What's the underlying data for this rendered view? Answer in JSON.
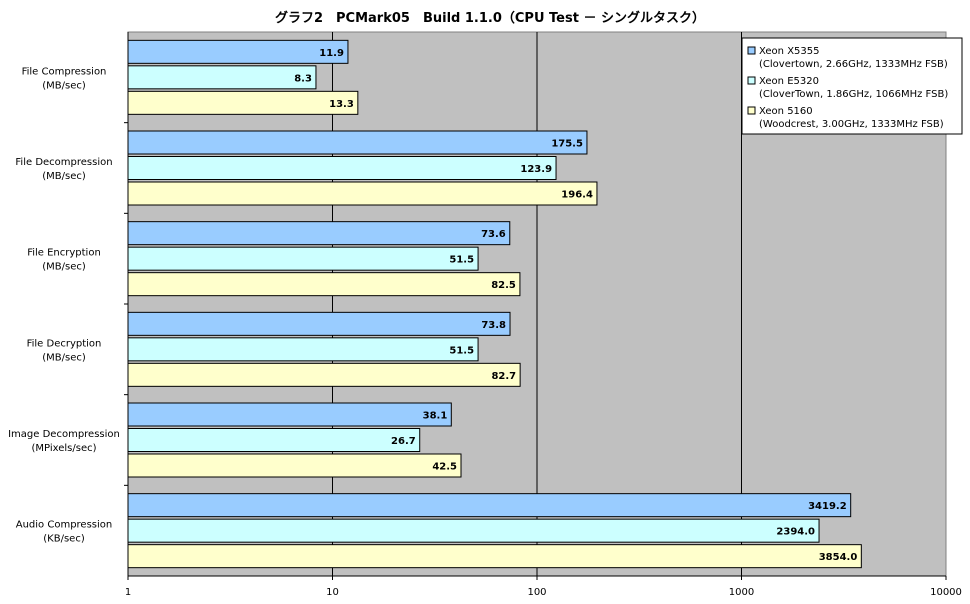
{
  "chart_data": {
    "type": "bar",
    "orientation": "horizontal",
    "title": "グラフ2　PCMark05　Build 1.1.0（CPU Test － シングルタスク）",
    "x_scale": "log",
    "xlim": [
      1,
      10000
    ],
    "x_ticks": [
      "1",
      "10",
      "100",
      "1000",
      "10000"
    ],
    "grid": "vertical major lines",
    "plot_background": "#c0c0c0",
    "legend_position": "top-right",
    "categories": [
      {
        "name": "File Compression",
        "unit": "(MB/sec)"
      },
      {
        "name": "File Decompression",
        "unit": "(MB/sec)"
      },
      {
        "name": "File Encryption",
        "unit": "(MB/sec)"
      },
      {
        "name": "File Decryption",
        "unit": "(MB/sec)"
      },
      {
        "name": "Image Decompression",
        "unit": "(MPixels/sec)"
      },
      {
        "name": "Audio Compression",
        "unit": "(KB/sec)"
      }
    ],
    "series": [
      {
        "name": "Xeon X5355",
        "detail": "(Clovertown, 2.66GHz, 1333MHz FSB)",
        "color": "#99ccff",
        "values": [
          11.9,
          175.5,
          73.6,
          73.8,
          38.1,
          3419.2
        ],
        "labels": [
          "11.9",
          "175.5",
          "73.6",
          "73.8",
          "38.1",
          "3419.2"
        ]
      },
      {
        "name": "Xeon E5320",
        "detail": "(CloverTown, 1.86GHz, 1066MHz FSB)",
        "color": "#ccffff",
        "values": [
          8.3,
          123.9,
          51.5,
          51.5,
          26.7,
          2394.0
        ],
        "labels": [
          "8.3",
          "123.9",
          "51.5",
          "51.5",
          "26.7",
          "2394.0"
        ]
      },
      {
        "name": "Xeon 5160",
        "detail": "(Woodcrest, 3.00GHz, 1333MHz FSB)",
        "color": "#ffffcc",
        "values": [
          13.3,
          196.4,
          82.5,
          82.7,
          42.5,
          3854.0
        ],
        "labels": [
          "13.3",
          "196.4",
          "82.5",
          "82.7",
          "42.5",
          "3854.0"
        ]
      }
    ]
  }
}
